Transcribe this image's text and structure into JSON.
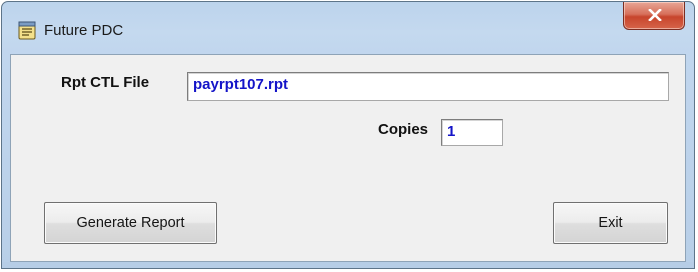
{
  "window": {
    "title": "Future PDC",
    "close_symbol": "x",
    "icon": "report-form-icon"
  },
  "form": {
    "rpt_ctl_label": "Rpt CTL File",
    "rpt_ctl_value": "payrpt107.rpt",
    "copies_label": "Copies",
    "copies_value": "1"
  },
  "buttons": {
    "generate_label": "Generate Report",
    "exit_label": "Exit"
  },
  "colors": {
    "field_text": "#1414c8",
    "titlebar": "#c4d9ef",
    "close_button": "#c7452c"
  }
}
